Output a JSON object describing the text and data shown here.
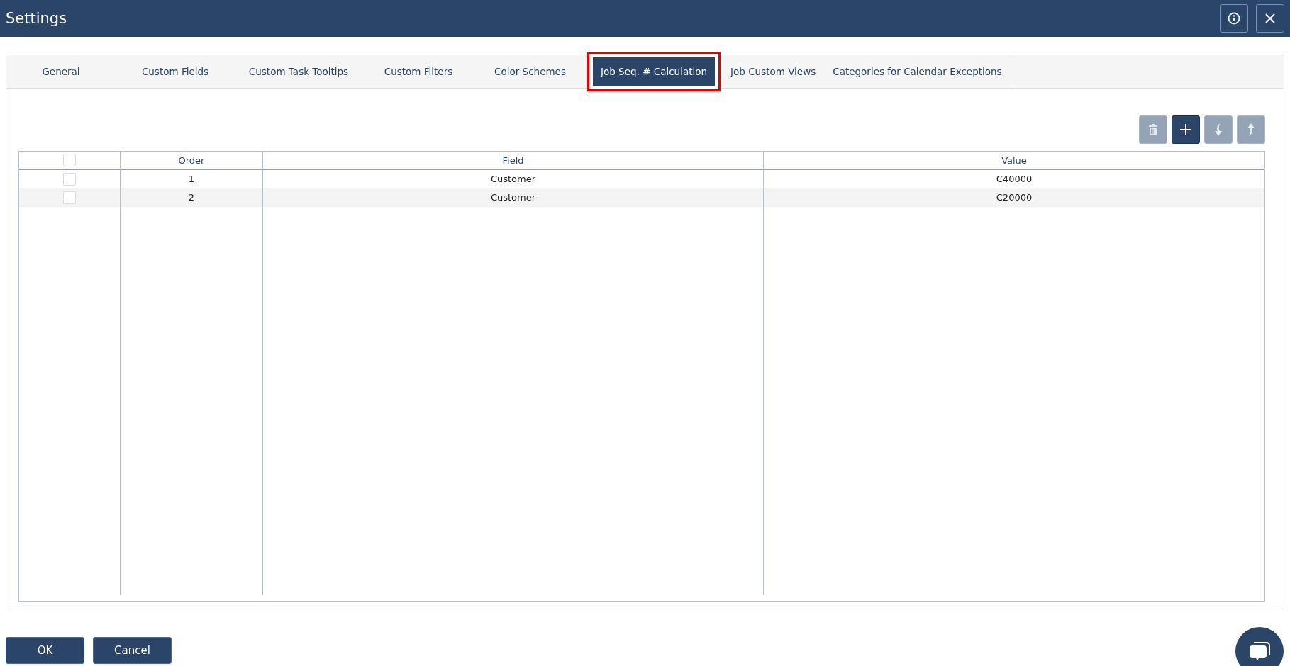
{
  "window": {
    "title": "Settings"
  },
  "tabs": [
    {
      "label": "General",
      "selected": false,
      "highlighted": false
    },
    {
      "label": "Custom Fields",
      "selected": false,
      "highlighted": false
    },
    {
      "label": "Custom Task Tooltips",
      "selected": false,
      "highlighted": false
    },
    {
      "label": "Custom Filters",
      "selected": false,
      "highlighted": false
    },
    {
      "label": "Color Schemes",
      "selected": false,
      "highlighted": false
    },
    {
      "label": "Job Seq. # Calculation",
      "selected": true,
      "highlighted": true
    },
    {
      "label": "Job Custom Views",
      "selected": false,
      "highlighted": false
    },
    {
      "label": "Categories for Calendar Exceptions",
      "selected": false,
      "highlighted": false
    }
  ],
  "toolbar": [
    {
      "kind": "delete",
      "disabled": true
    },
    {
      "kind": "add",
      "disabled": false
    },
    {
      "kind": "down",
      "disabled": true
    },
    {
      "kind": "up",
      "disabled": true
    }
  ],
  "table": {
    "header_checked": false,
    "columns": [
      "Order",
      "Field",
      "Value"
    ],
    "rows": [
      {
        "checked": false,
        "cells": [
          "1",
          "Customer",
          "C40000"
        ]
      },
      {
        "checked": false,
        "cells": [
          "2",
          "Customer",
          "C20000"
        ]
      }
    ]
  },
  "buttons": [
    "OK",
    "Cancel"
  ]
}
